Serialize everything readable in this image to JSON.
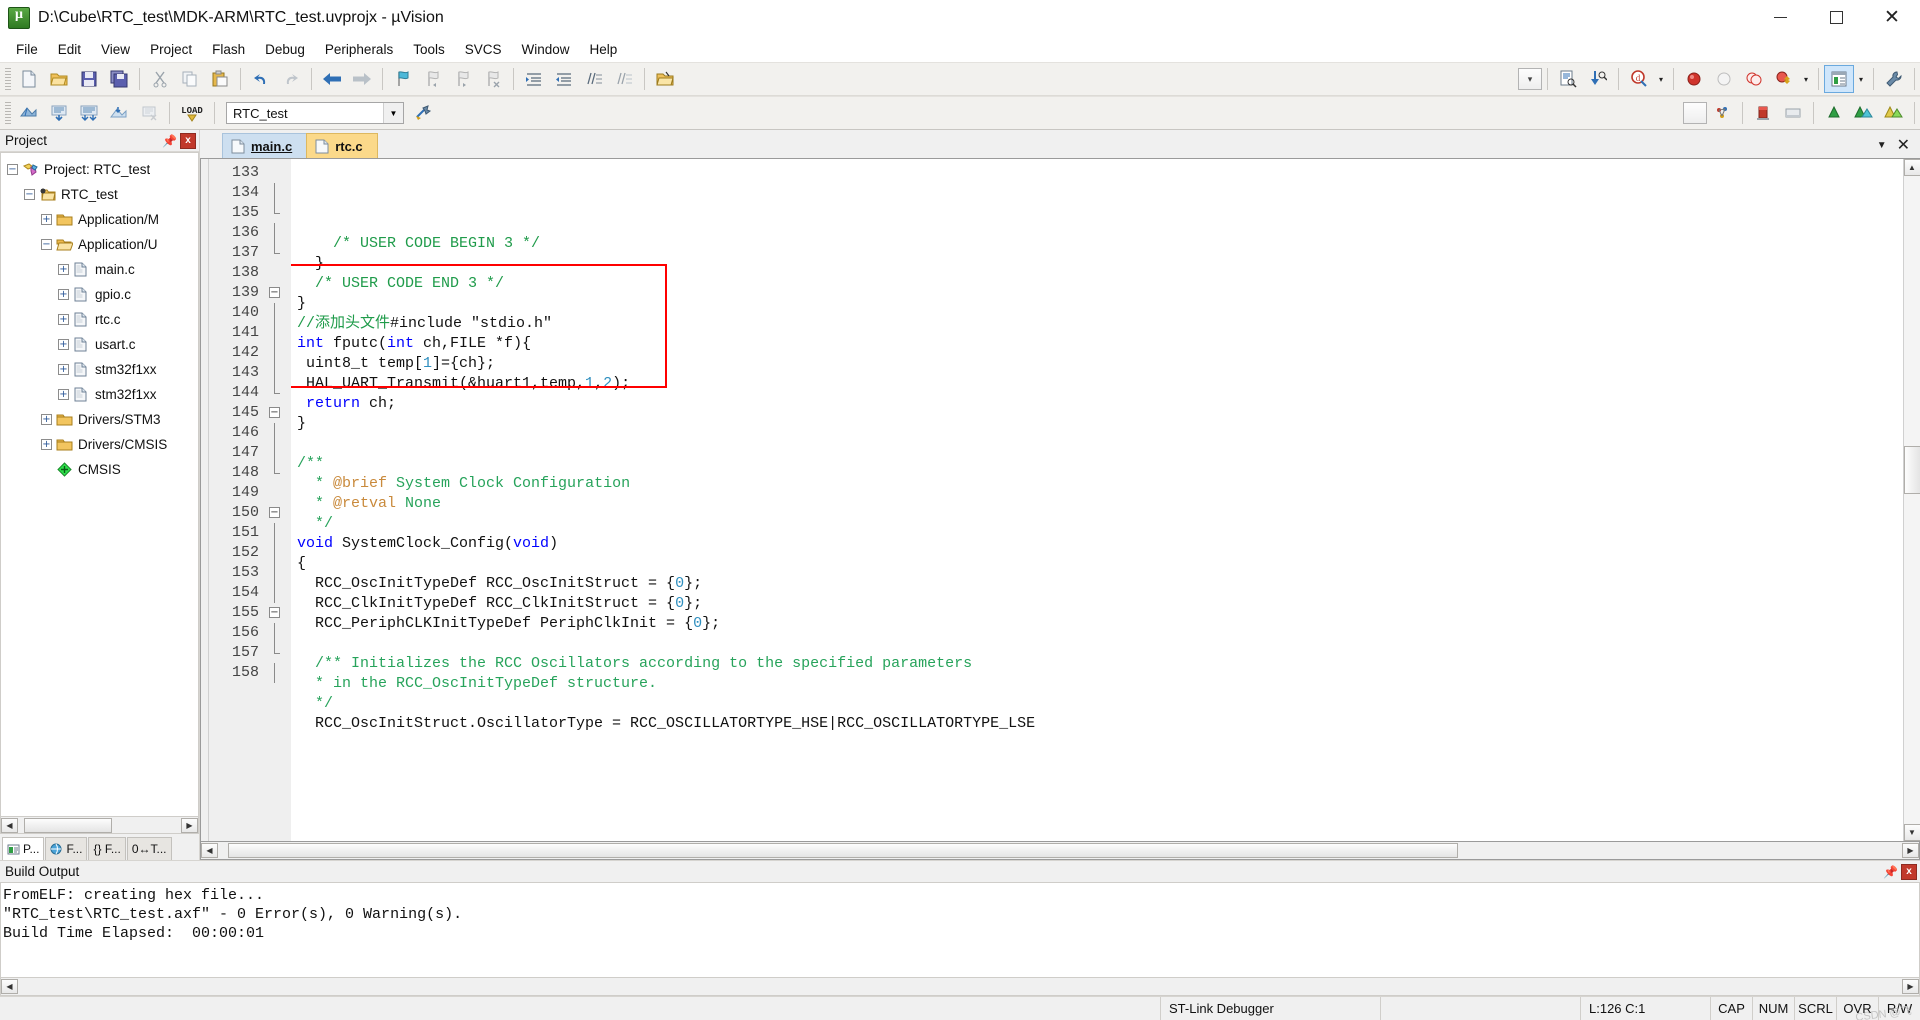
{
  "window": {
    "title": "D:\\Cube\\RTC_test\\MDK-ARM\\RTC_test.uvprojx - µVision",
    "app_icon": "uvision-logo-icon",
    "minimize": "–",
    "maximize": "❐",
    "close": "✕"
  },
  "menu": {
    "items": [
      "File",
      "Edit",
      "View",
      "Project",
      "Flash",
      "Debug",
      "Peripherals",
      "Tools",
      "SVCS",
      "Window",
      "Help"
    ]
  },
  "toolbar1": {
    "icons": [
      "new-file-icon",
      "open-file-icon",
      "save-icon",
      "save-all-icon",
      "cut-icon",
      "copy-icon",
      "paste-icon",
      "undo-icon",
      "redo-icon",
      "navigate-back-icon",
      "navigate-forward-icon",
      "bookmark-toggle-icon",
      "bookmark-prev-icon",
      "bookmark-next-icon",
      "bookmark-clear-icon",
      "indent-icon",
      "outdent-icon",
      "comment-icon",
      "uncomment-icon",
      "open-folder-icon"
    ],
    "combo_placeholder": "",
    "more_icons": [
      "configure-icon",
      "find-in-files-icon",
      "magnify-d-icon"
    ],
    "debug_icons": [
      "insert-breakpoint-icon",
      "kill-breakpoint-icon",
      "disable-breakpoint-icon",
      "kill-all-breakpoints-icon"
    ],
    "window_icon": "manage-windows-icon",
    "tools_icon": "configure-target-icon"
  },
  "toolbar2": {
    "icons": [
      "translate-icon",
      "build-icon",
      "rebuild-icon",
      "batch-build-icon",
      "stop-build-icon",
      "load-icon"
    ],
    "target_select": "RTC_test",
    "target_arrow": "chevron-down-icon",
    "manage_icon": "manage-project-items-icon",
    "more": [
      "multi-project-icon",
      "books-icon",
      "debug-green-icon",
      "simulator-icon",
      "analysis-icon"
    ]
  },
  "project_panel": {
    "title": "Project",
    "pin_icon": "pin-icon",
    "close_icon": "close-icon",
    "tree": [
      {
        "label": "Project: RTC_test",
        "indent": 0,
        "expander": "−",
        "icon": "project-icon"
      },
      {
        "label": "RTC_test",
        "indent": 1,
        "expander": "−",
        "icon": "target-folder-icon"
      },
      {
        "label": "Application/M",
        "indent": 2,
        "expander": "+",
        "icon": "group-folder-icon"
      },
      {
        "label": "Application/U",
        "indent": 2,
        "expander": "−",
        "icon": "group-folder-open-icon"
      },
      {
        "label": "main.c",
        "indent": 3,
        "expander": "+",
        "icon": "c-file-icon"
      },
      {
        "label": "gpio.c",
        "indent": 3,
        "expander": "+",
        "icon": "c-file-icon"
      },
      {
        "label": "rtc.c",
        "indent": 3,
        "expander": "+",
        "icon": "c-file-icon"
      },
      {
        "label": "usart.c",
        "indent": 3,
        "expander": "+",
        "icon": "c-file-icon"
      },
      {
        "label": "stm32f1xx",
        "indent": 3,
        "expander": "+",
        "icon": "c-file-icon"
      },
      {
        "label": "stm32f1xx",
        "indent": 3,
        "expander": "+",
        "icon": "c-file-icon"
      },
      {
        "label": "Drivers/STM3",
        "indent": 2,
        "expander": "+",
        "icon": "group-folder-icon"
      },
      {
        "label": "Drivers/CMSIS",
        "indent": 2,
        "expander": "+",
        "icon": "group-folder-icon"
      },
      {
        "label": "CMSIS",
        "indent": 2,
        "expander": "",
        "icon": "cmsis-diamond-icon"
      }
    ],
    "tabs": [
      {
        "label": "P...",
        "icon": "project-tab-icon",
        "selected": true
      },
      {
        "label": "F...",
        "icon": "books-tab-icon",
        "selected": false
      },
      {
        "label": "{} F...",
        "icon": "functions-tab-icon",
        "selected": false
      },
      {
        "label": "0↔T...",
        "icon": "templates-tab-icon",
        "selected": false
      }
    ]
  },
  "editor": {
    "tabs": [
      {
        "label": "main.c",
        "icon": "c-file-icon",
        "active": true
      },
      {
        "label": "rtc.c",
        "icon": "c-file-icon",
        "active": false
      }
    ],
    "collapse_icon": "chevron-down-icon",
    "close_icon": "close-icon",
    "first_line": 133,
    "lines": [
      {
        "n": 133,
        "segs": []
      },
      {
        "n": 134,
        "segs": [
          {
            "t": "    /* USER CODE BEGIN 3 */",
            "c": "cm"
          }
        ]
      },
      {
        "n": 135,
        "segs": [
          {
            "t": "  }",
            "c": ""
          }
        ]
      },
      {
        "n": 136,
        "segs": [
          {
            "t": "  /* USER CODE END 3 */",
            "c": "cm"
          }
        ]
      },
      {
        "n": 137,
        "segs": [
          {
            "t": "}",
            "c": ""
          }
        ]
      },
      {
        "n": 138,
        "segs": [
          {
            "t": "//添加头文件",
            "c": "cm"
          },
          {
            "t": "#include \"stdio.h\"",
            "c": ""
          }
        ]
      },
      {
        "n": 139,
        "segs": [
          {
            "t": "int",
            "c": "k"
          },
          {
            "t": " fputc(",
            "c": ""
          },
          {
            "t": "int",
            "c": "k"
          },
          {
            "t": " ch,FILE *f){",
            "c": ""
          }
        ]
      },
      {
        "n": 140,
        "segs": [
          {
            "t": " uint8_t temp[",
            "c": ""
          },
          {
            "t": "1",
            "c": "num"
          },
          {
            "t": "]={ch};",
            "c": ""
          }
        ]
      },
      {
        "n": 141,
        "segs": [
          {
            "t": " HAL_UART_Transmit(&huart1,temp,",
            "c": ""
          },
          {
            "t": "1",
            "c": "num"
          },
          {
            "t": ",",
            "c": ""
          },
          {
            "t": "2",
            "c": "num"
          },
          {
            "t": ");",
            "c": ""
          }
        ]
      },
      {
        "n": 142,
        "segs": [
          {
            "t": " ",
            "c": ""
          },
          {
            "t": "return",
            "c": "k"
          },
          {
            "t": " ch;",
            "c": ""
          }
        ]
      },
      {
        "n": 143,
        "segs": [
          {
            "t": "}",
            "c": ""
          }
        ]
      },
      {
        "n": 144,
        "segs": []
      },
      {
        "n": 145,
        "segs": [
          {
            "t": "/**",
            "c": "doc"
          }
        ]
      },
      {
        "n": 146,
        "segs": [
          {
            "t": "  * ",
            "c": "doc"
          },
          {
            "t": "@brief",
            "c": "at"
          },
          {
            "t": " System Clock Configuration",
            "c": "doc"
          }
        ]
      },
      {
        "n": 147,
        "segs": [
          {
            "t": "  * ",
            "c": "doc"
          },
          {
            "t": "@retval",
            "c": "at"
          },
          {
            "t": " None",
            "c": "doc"
          }
        ]
      },
      {
        "n": 148,
        "segs": [
          {
            "t": "  */",
            "c": "doc"
          }
        ]
      },
      {
        "n": 149,
        "segs": [
          {
            "t": "void",
            "c": "k"
          },
          {
            "t": " SystemClock_Config(",
            "c": ""
          },
          {
            "t": "void",
            "c": "k"
          },
          {
            "t": ")",
            "c": ""
          }
        ]
      },
      {
        "n": 150,
        "segs": [
          {
            "t": "{",
            "c": ""
          }
        ]
      },
      {
        "n": 151,
        "segs": [
          {
            "t": "  RCC_OscInitTypeDef RCC_OscInitStruct = {",
            "c": ""
          },
          {
            "t": "0",
            "c": "num"
          },
          {
            "t": "};",
            "c": ""
          }
        ]
      },
      {
        "n": 152,
        "segs": [
          {
            "t": "  RCC_ClkInitTypeDef RCC_ClkInitStruct = {",
            "c": ""
          },
          {
            "t": "0",
            "c": "num"
          },
          {
            "t": "};",
            "c": ""
          }
        ]
      },
      {
        "n": 153,
        "segs": [
          {
            "t": "  RCC_PeriphCLKInitTypeDef PeriphClkInit = {",
            "c": ""
          },
          {
            "t": "0",
            "c": "num"
          },
          {
            "t": "};",
            "c": ""
          }
        ]
      },
      {
        "n": 154,
        "segs": []
      },
      {
        "n": 155,
        "segs": [
          {
            "t": "  /** Initializes the RCC Oscillators according to the specified parameters",
            "c": "doc"
          }
        ]
      },
      {
        "n": 156,
        "segs": [
          {
            "t": "  * in the RCC_OscInitTypeDef structure.",
            "c": "doc"
          }
        ]
      },
      {
        "n": 157,
        "segs": [
          {
            "t": "  */",
            "c": "doc"
          }
        ]
      },
      {
        "n": 158,
        "segs": [
          {
            "t": "  RCC_OscInitStruct.OscillatorType = RCC_OSCILLATORTYPE_HSE|RCC_OSCILLATORTYPE_LSE",
            "c": ""
          }
        ]
      }
    ],
    "annotation_color": "#ff0000"
  },
  "build_output": {
    "title": "Build Output",
    "pin_icon": "pin-icon",
    "close_icon": "close-icon",
    "lines": [
      "FromELF: creating hex file...",
      "\"RTC_test\\RTC_test.axf\" - 0 Error(s), 0 Warning(s).",
      "Build Time Elapsed:  00:00:01"
    ]
  },
  "statusbar": {
    "message": "",
    "debugger": "ST-Link Debugger",
    "position": "L:126 C:1",
    "flags": [
      "CAP",
      "NUM",
      "SCRL",
      "OVR",
      "R/W"
    ],
    "watermark": "CSDN @飞"
  }
}
